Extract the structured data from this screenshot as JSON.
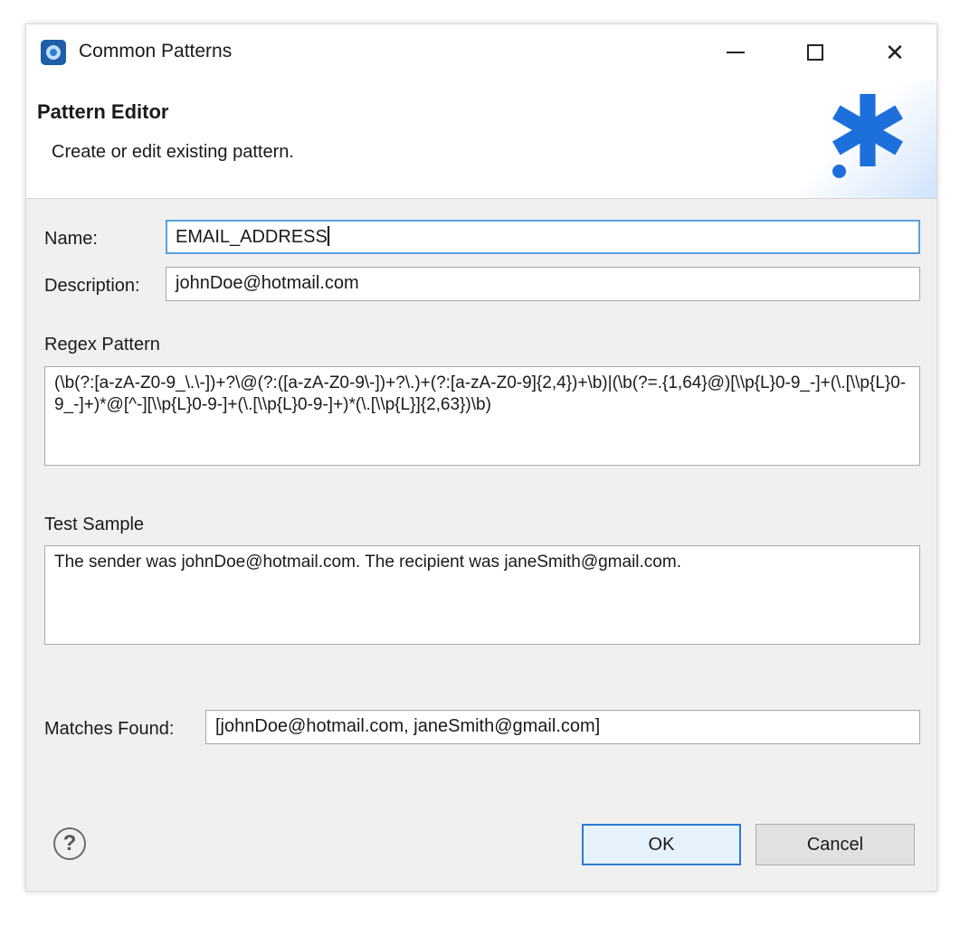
{
  "window": {
    "title": "Common Patterns",
    "icon": "app-icon",
    "controls": {
      "minimize": "minimize-icon",
      "maximize": "maximize-icon",
      "close": "close-icon",
      "close_glyph": "✕"
    }
  },
  "banner": {
    "title": "Pattern Editor",
    "description": "Create or edit existing pattern.",
    "graphic": "asterisk-icon",
    "graphic_glyph": "✱",
    "accent_color": "#1d6fdc"
  },
  "form": {
    "name_label": "Name:",
    "name_value": "EMAIL_ADDRESS",
    "description_label": "Description:",
    "description_value": "johnDoe@hotmail.com",
    "regex_label": "Regex Pattern",
    "regex_value": "(\\b(?:[a-zA-Z0-9_\\.\\-])+?\\@(?:([a-zA-Z0-9\\-])+?\\.)+(?:[a-zA-Z0-9]{2,4})+\\b)|(\\b(?=.{1,64}@)[\\\\p{L}0-9_-]+(\\.[\\\\p{L}0-9_-]+)*@[^-][\\\\p{L}0-9-]+(\\.[\\\\p{L}0-9-]+)*(\\.[\\\\p{L}]{2,63})\\b)",
    "test_label": "Test Sample",
    "test_value": "The sender was johnDoe@hotmail.com. The recipient was janeSmith@gmail.com.",
    "matches_label": "Matches Found:",
    "matches_value": "[johnDoe@hotmail.com, janeSmith@gmail.com]"
  },
  "footer": {
    "help_glyph": "?",
    "help_icon": "help-icon",
    "ok_label": "OK",
    "cancel_label": "Cancel"
  }
}
